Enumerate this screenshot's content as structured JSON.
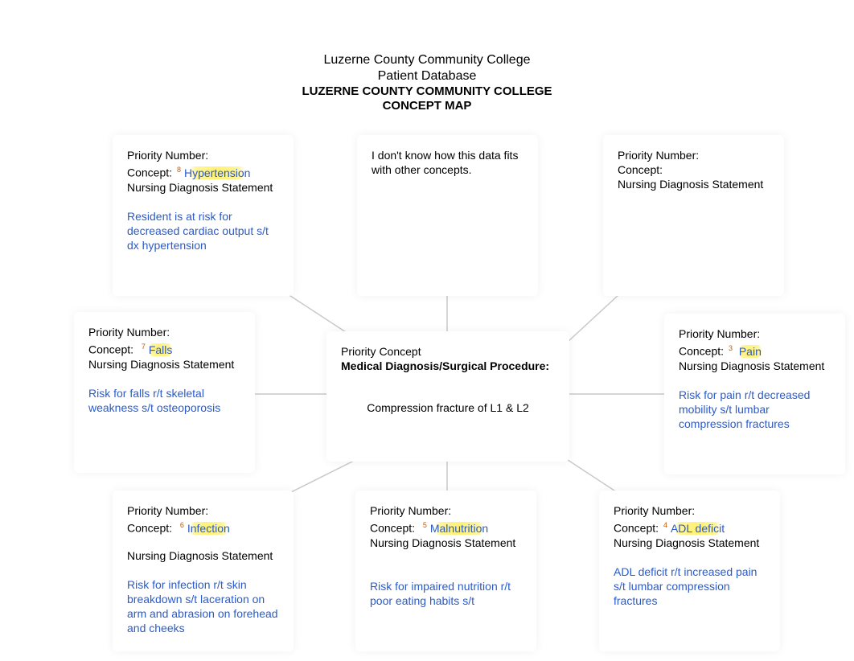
{
  "header": {
    "line1": "Luzerne County Community College",
    "line2": "Patient Database",
    "line3": "LUZERNE COUNTY COMMUNITY COLLEGE",
    "line4": "CONCEPT MAP"
  },
  "labels": {
    "priority": "Priority Number:",
    "concept": "Concept:",
    "nds": "Nursing Diagnosis Statement",
    "priority_concept": "Priority Concept",
    "med_dx": "Medical Diagnosis/Surgical Procedure:"
  },
  "center": {
    "dx": "Compression fracture of L1 & L2"
  },
  "boxes": {
    "tl": {
      "sup": "8",
      "concept": "Hypertension",
      "stmt": "Resident is at risk for decreased cardiac output s/t dx hypertension"
    },
    "tm": {
      "text": "I don't know how this data fits with other concepts."
    },
    "tr": {
      "concept": "",
      "stmt": ""
    },
    "ml": {
      "sup": "7",
      "concept": "Falls",
      "stmt": "Risk for falls r/t skeletal weakness s/t osteoporosis"
    },
    "mr": {
      "sup": "3",
      "concept": "Pain",
      "stmt": "Risk for pain r/t decreased mobility s/t lumbar compression fractures"
    },
    "bl": {
      "sup": "6",
      "concept": "Infection",
      "stmt": "Risk for infection r/t skin breakdown s/t laceration on arm and abrasion on forehead and cheeks"
    },
    "bm": {
      "sup": "5",
      "concept": "Malnutrition",
      "stmt": "Risk for impaired nutrition r/t poor eating habits s/t"
    },
    "br": {
      "sup": "4",
      "concept": "ADL deficit",
      "stmt": "ADL deficit r/t increased pain s/t lumbar compression fractures"
    }
  }
}
